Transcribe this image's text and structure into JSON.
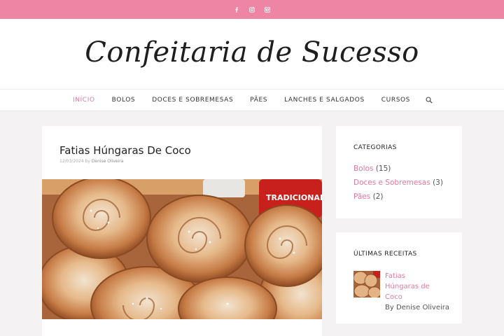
{
  "social": [
    {
      "icon": "facebook-icon"
    },
    {
      "icon": "instagram-icon"
    },
    {
      "icon": "instagram-alt-icon"
    }
  ],
  "site": {
    "title": "Confeitaria de Sucesso"
  },
  "nav": {
    "items": [
      "INÍCIO",
      "BOLOS",
      "DOCES E SOBREMESAS",
      "PÃES",
      "LANCHES E SALGADOS",
      "CURSOS"
    ],
    "active_color": "#e27a9b"
  },
  "post": {
    "title": "Fatias Húngaras De Coco",
    "date": "12/03/2024",
    "by": "by",
    "author": "Denise Oliveira",
    "image_label": "TRADICIONAL"
  },
  "categories": {
    "title": "CATEGORIAS",
    "items": [
      {
        "name": "Bolos",
        "count": "(15)"
      },
      {
        "name": "Doces e Sobremesas",
        "count": "(3)"
      },
      {
        "name": "Pães",
        "count": "(2)"
      }
    ]
  },
  "recent": {
    "title": "ÚLTIMAS RECEITAS",
    "item_title": "Fatias Húngaras de Coco",
    "item_by": "By Denise Oliveira"
  },
  "colors": {
    "topbar": "#ee85a4",
    "accent": "#e27a9b",
    "background": "#f4f2f3"
  }
}
